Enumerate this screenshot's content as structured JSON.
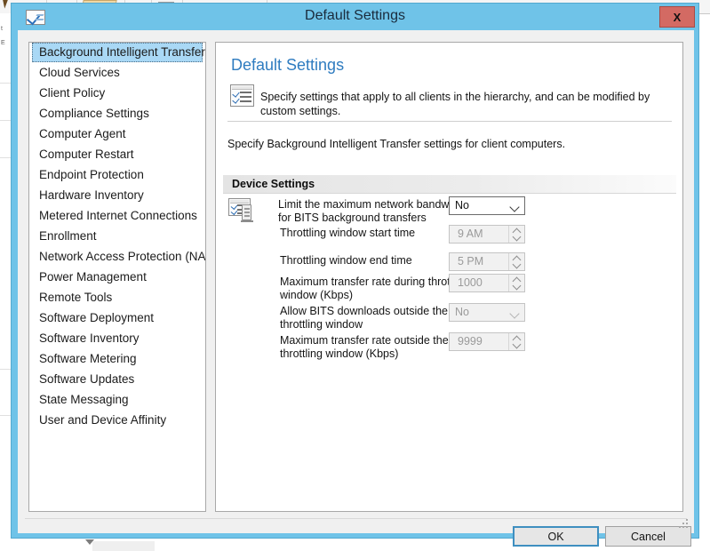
{
  "window": {
    "title": "Default Settings",
    "icon": "checkbox-checked-icon",
    "close_label": "X",
    "titlebar_color": "#6fc3e8",
    "close_color": "#d36a63"
  },
  "sidebar": {
    "items": [
      {
        "label": "Background Intelligent Transfer",
        "selected": true
      },
      {
        "label": "Cloud Services",
        "selected": false
      },
      {
        "label": "Client Policy",
        "selected": false
      },
      {
        "label": "Compliance Settings",
        "selected": false
      },
      {
        "label": "Computer Agent",
        "selected": false
      },
      {
        "label": "Computer Restart",
        "selected": false
      },
      {
        "label": "Endpoint Protection",
        "selected": false
      },
      {
        "label": "Hardware Inventory",
        "selected": false
      },
      {
        "label": "Metered Internet Connections",
        "selected": false
      },
      {
        "label": "Enrollment",
        "selected": false
      },
      {
        "label": "Network Access Protection (NAP)",
        "selected": false
      },
      {
        "label": "Power Management",
        "selected": false
      },
      {
        "label": "Remote Tools",
        "selected": false
      },
      {
        "label": "Software Deployment",
        "selected": false
      },
      {
        "label": "Software Inventory",
        "selected": false
      },
      {
        "label": "Software Metering",
        "selected": false
      },
      {
        "label": "Software Updates",
        "selected": false
      },
      {
        "label": "State Messaging",
        "selected": false
      },
      {
        "label": "User and Device Affinity",
        "selected": false
      }
    ]
  },
  "panel": {
    "heading": "Default Settings",
    "heading_color": "#2f7cc0",
    "description": "Specify settings that apply to all clients in the hierarchy, and can be modified by custom settings.",
    "subtext": "Specify Background Intelligent Transfer settings for client computers.",
    "section_title": "Device Settings",
    "settings": [
      {
        "label": "Limit the maximum network bandwidth for BITS background transfers",
        "control": "combo",
        "value": "No",
        "enabled": true
      },
      {
        "label": "Throttling window start time",
        "control": "spinner",
        "value": "9 AM",
        "enabled": false
      },
      {
        "label": "Throttling window end time",
        "control": "spinner",
        "value": "5 PM",
        "enabled": false
      },
      {
        "label": "Maximum transfer rate during throttling window (Kbps)",
        "control": "spinner",
        "value": "1000",
        "enabled": false
      },
      {
        "label": "Allow BITS downloads outside the throttling window",
        "control": "combo",
        "value": "No",
        "enabled": false
      },
      {
        "label": "Maximum transfer rate outside the throttling window (Kbps)",
        "control": "spinner",
        "value": "9999",
        "enabled": false
      }
    ]
  },
  "footer": {
    "ok_label": "OK",
    "cancel_label": "Cancel"
  }
}
